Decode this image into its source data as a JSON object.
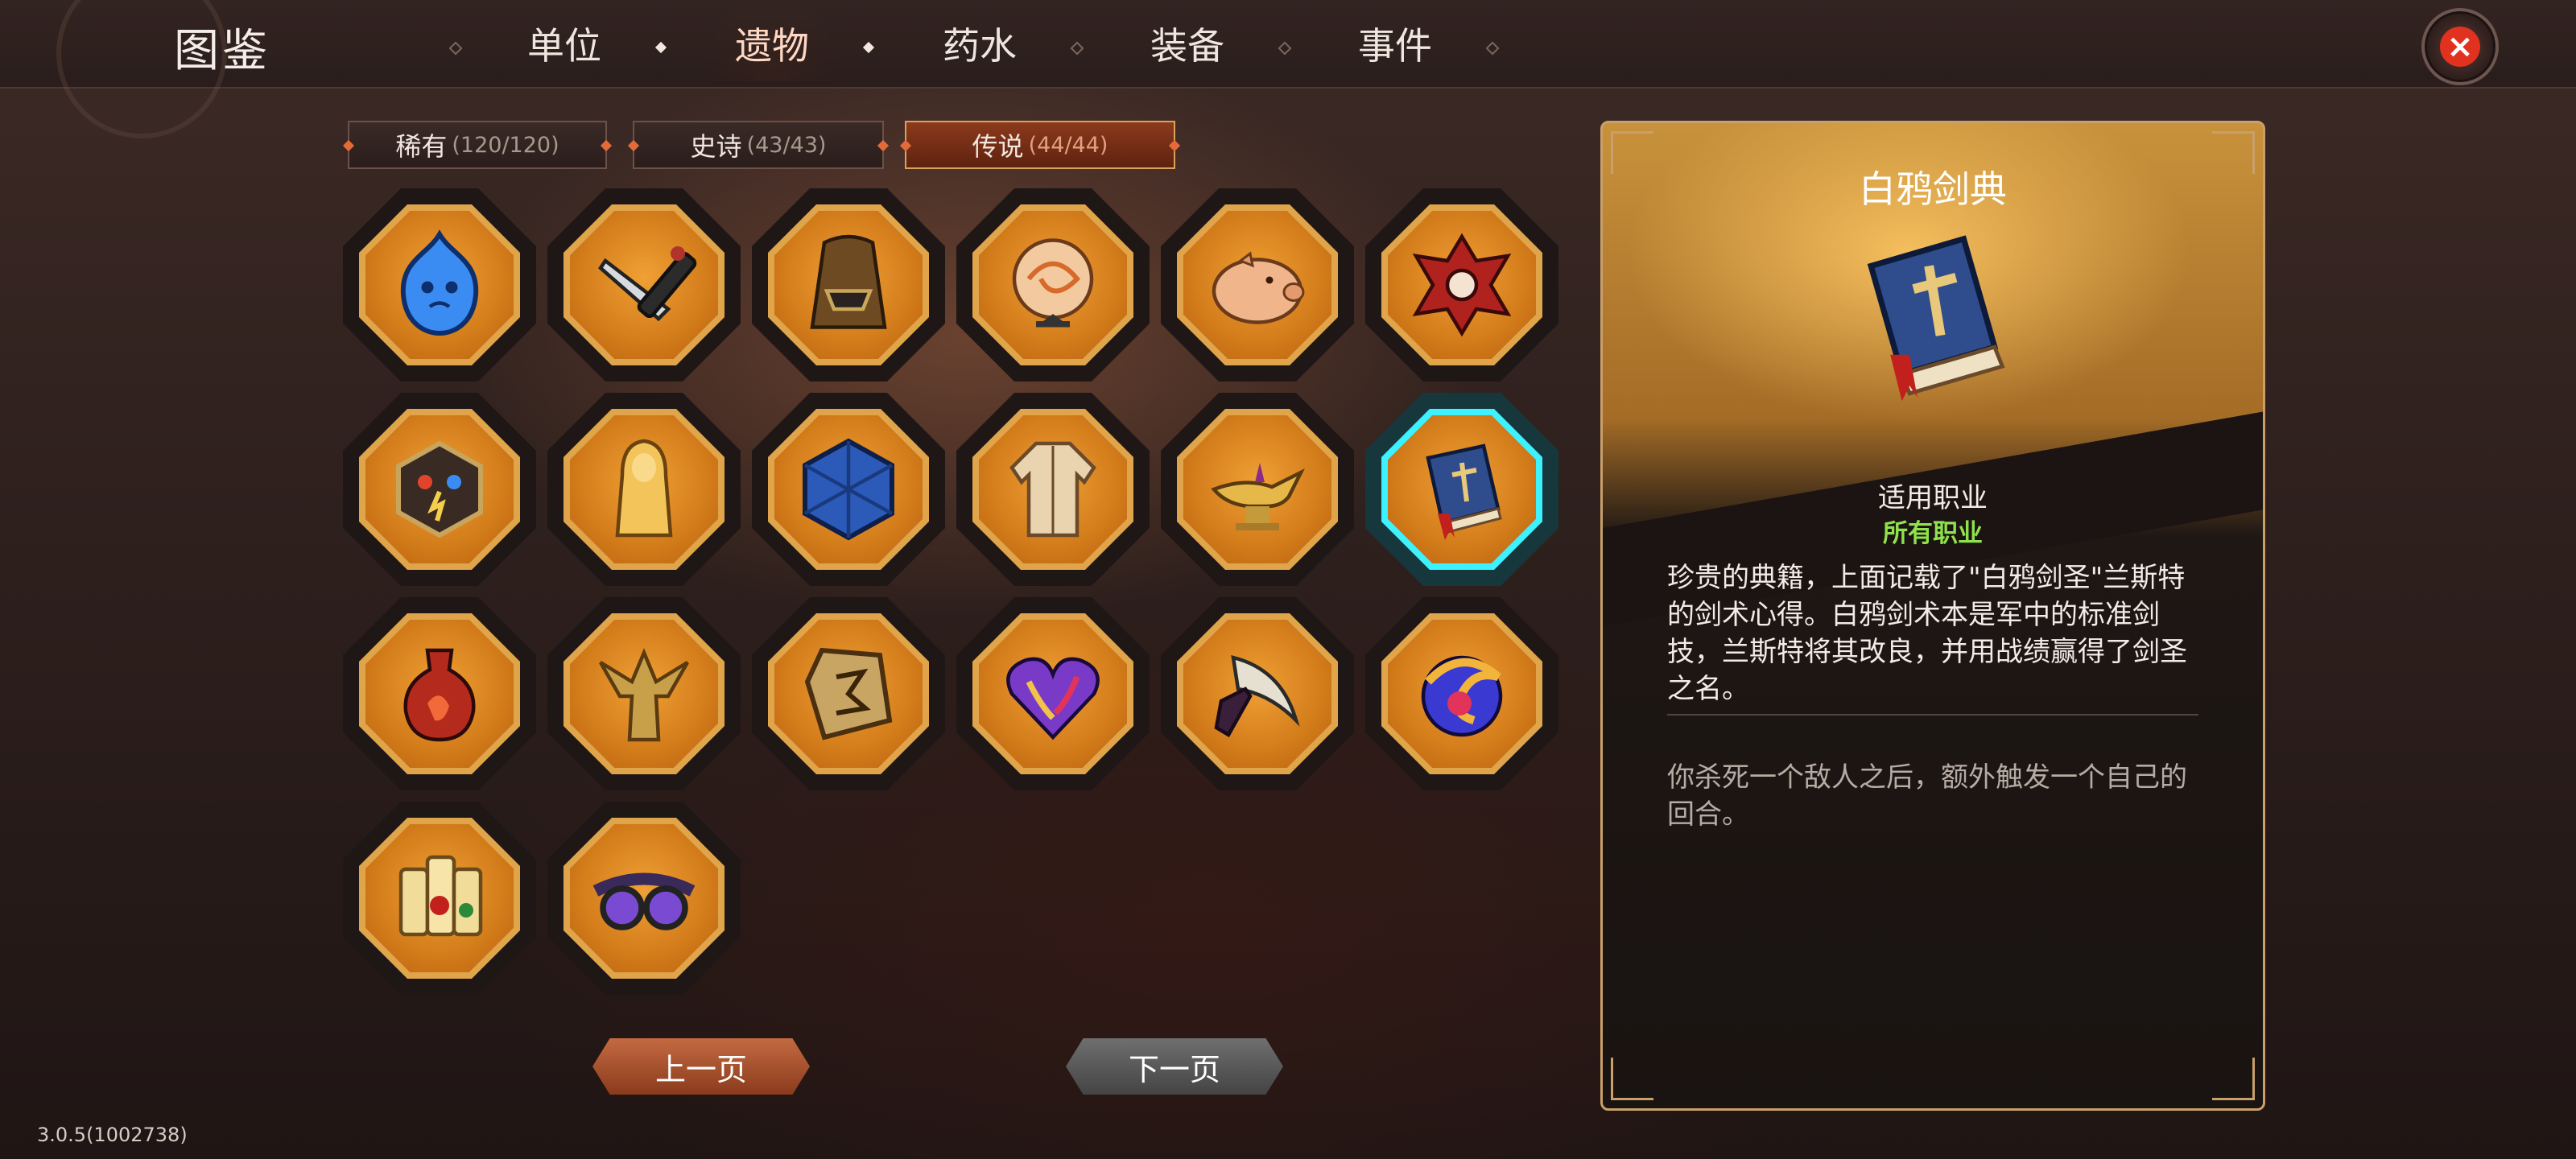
{
  "header": {
    "title": "图鉴",
    "tabs": [
      {
        "label": "单位"
      },
      {
        "label": "遗物",
        "active": true
      },
      {
        "label": "药水"
      },
      {
        "label": "装备"
      },
      {
        "label": "事件"
      }
    ],
    "close_icon": "close-icon",
    "accent_color": "#e0321f"
  },
  "categories": [
    {
      "label": "稀有",
      "count": "(120/120)"
    },
    {
      "label": "史诗",
      "count": "(43/43)"
    },
    {
      "label": "传说",
      "count": "(44/44)",
      "active": true
    }
  ],
  "relics": [
    {
      "icon": "blue-slime-icon"
    },
    {
      "icon": "dagger-sheath-icon"
    },
    {
      "icon": "hooded-cloak-mask-icon"
    },
    {
      "icon": "crystal-orb-icon"
    },
    {
      "icon": "piggy-bank-icon"
    },
    {
      "icon": "crimson-crest-icon"
    },
    {
      "icon": "elemental-hexagon-icon"
    },
    {
      "icon": "golden-statue-icon"
    },
    {
      "icon": "blue-cube-icon"
    },
    {
      "icon": "robe-icon"
    },
    {
      "icon": "magic-lamp-icon"
    },
    {
      "icon": "holy-book-icon",
      "selected": true
    },
    {
      "icon": "fire-potion-icon"
    },
    {
      "icon": "winged-statue-icon"
    },
    {
      "icon": "rune-stone-icon"
    },
    {
      "icon": "rainbow-heart-icon"
    },
    {
      "icon": "curved-knife-icon"
    },
    {
      "icon": "swirl-orb-icon"
    },
    {
      "icon": "scroll-bundle-icon"
    },
    {
      "icon": "goggles-icon"
    }
  ],
  "pager": {
    "prev_label": "上一页",
    "next_label": "下一页"
  },
  "detail": {
    "title": "白鸦剑典",
    "icon": "holy-book-icon",
    "class_label": "适用职业",
    "class_value": "所有职业",
    "description": "珍贵的典籍，上面记载了\"白鸦剑圣\"兰斯特的剑术心得。白鸦剑术本是军中的标准剑技，兰斯特将其改良，并用战绩赢得了剑圣之名。",
    "effect": "你杀死一个敌人之后，额外触发一个自己的回合。"
  },
  "version": "3.0.5(1002738)"
}
